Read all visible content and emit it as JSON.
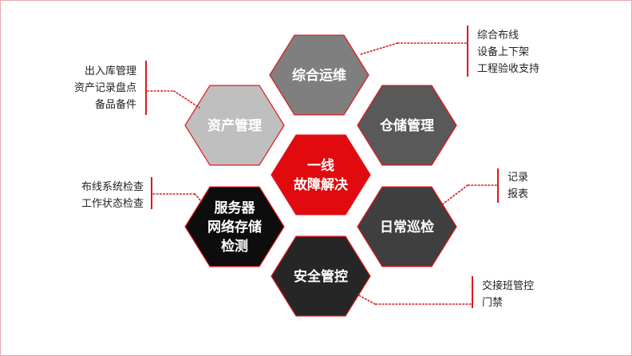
{
  "colors": {
    "hex_stroke": "#e0161c",
    "connector": "#d9161c",
    "bracket": "#e0161c"
  },
  "hexagons": [
    {
      "id": "comprehensive",
      "lines": [
        "综合运维"
      ],
      "fill": "#7f7f7f",
      "icon": "none"
    },
    {
      "id": "asset",
      "lines": [
        "资产管理"
      ],
      "fill": "#bfbfbf",
      "icon": "none"
    },
    {
      "id": "storage",
      "lines": [
        "仓储管理"
      ],
      "fill": "#595959",
      "icon": "none"
    },
    {
      "id": "frontline",
      "lines": [
        "一线",
        "故障解决"
      ],
      "fill": "#e10a0f",
      "icon": "none"
    },
    {
      "id": "server",
      "lines": [
        "服务器",
        "网络存储",
        "检测"
      ],
      "fill": "#0d0d0d",
      "icon": "none"
    },
    {
      "id": "patrol",
      "lines": [
        "日常巡检"
      ],
      "fill": "#3f3f3f",
      "icon": "none"
    },
    {
      "id": "security",
      "lines": [
        "安全管控"
      ],
      "fill": "#262626",
      "icon": "none"
    }
  ],
  "annotations": {
    "asset": [
      "出入库管理",
      "资产记录盘点",
      "备品备件"
    ],
    "server": [
      "布线系统检查",
      "工作状态检查"
    ],
    "comprehensive": [
      "综合布线",
      "设备上下架",
      "工程验收支持"
    ],
    "patrol": [
      "记录",
      "报表"
    ],
    "security": [
      "交接班管控",
      "门禁"
    ]
  }
}
